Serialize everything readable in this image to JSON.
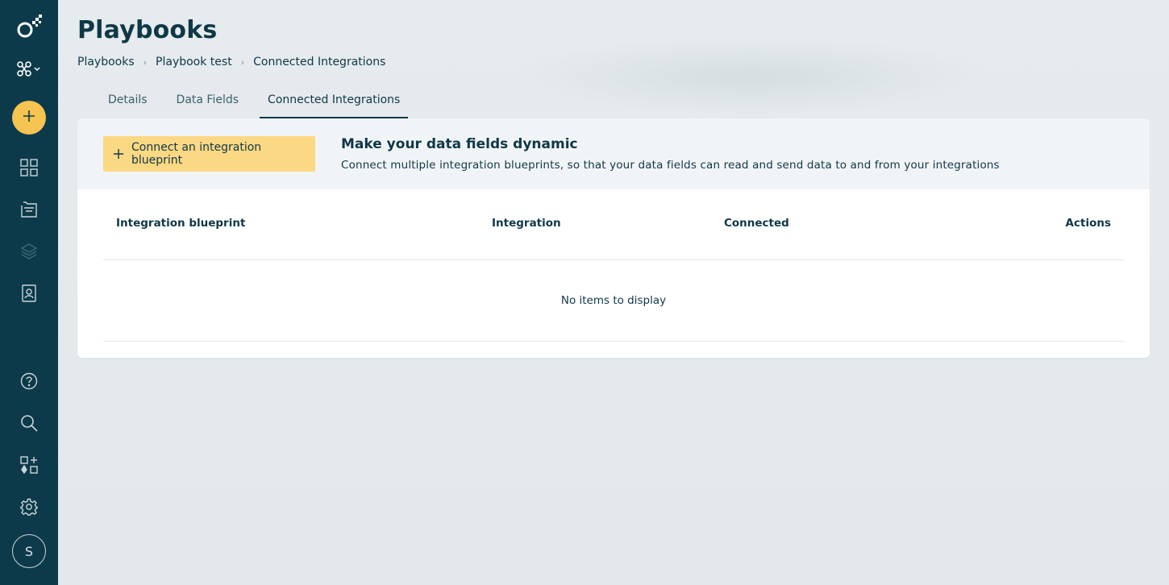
{
  "sidebar": {
    "logo_icon": "brand-logo-icon",
    "module_switch_icon": "modules-icon",
    "create_icon": "plus-icon",
    "nav_icons": [
      "dashboard-icon",
      "folder-icon",
      "layers-icon",
      "contacts-icon"
    ],
    "bottom_icons": [
      "help-icon",
      "search-icon",
      "integrations-icon",
      "gear-icon"
    ],
    "avatar_initial": "S"
  },
  "header": {
    "title": "Playbooks",
    "breadcrumb": [
      "Playbooks",
      "Playbook test",
      "Connected Integrations"
    ]
  },
  "tabs": [
    {
      "label": "Details",
      "active": false
    },
    {
      "label": "Data Fields",
      "active": false
    },
    {
      "label": "Connected Integrations",
      "active": true
    }
  ],
  "banner": {
    "button_label": "Connect an integration blueprint",
    "title": "Make your data fields dynamic",
    "description": "Connect multiple integration blueprints, so that your data fields can read and send data to and from your integrations"
  },
  "table": {
    "columns": [
      "Integration blueprint",
      "Integration",
      "Connected",
      "Actions"
    ],
    "empty_text": "No items to display"
  },
  "colors": {
    "sidebar": "#0d3a4a",
    "accent": "#f5c451",
    "button": "#fbd883",
    "text": "#0f3847"
  }
}
